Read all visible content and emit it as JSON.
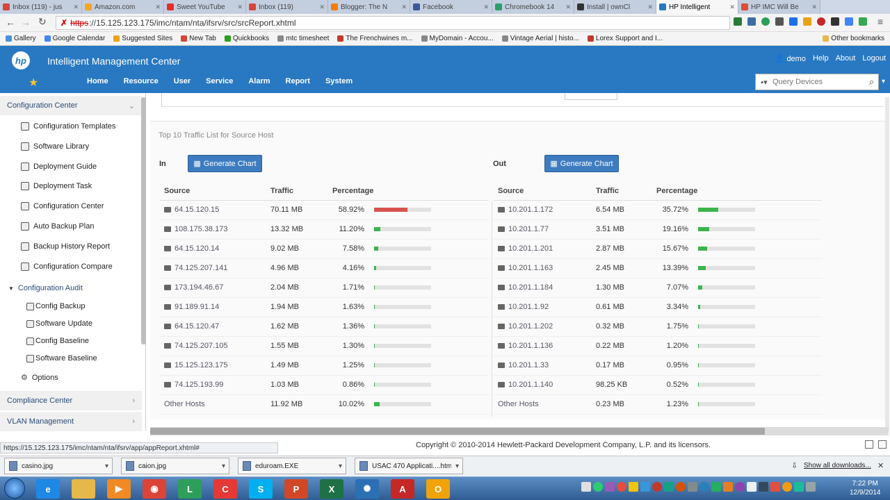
{
  "browser": {
    "tabs": [
      {
        "label": "Inbox (119) - jus",
        "color": "#d44638",
        "active": false
      },
      {
        "label": "Amazon.com",
        "color": "#f5a623",
        "active": false
      },
      {
        "label": "Sweet YouTube",
        "color": "#e52d27",
        "active": false
      },
      {
        "label": "Inbox (119)",
        "color": "#d44638",
        "active": false
      },
      {
        "label": "Blogger: The N",
        "color": "#f57d00",
        "active": false
      },
      {
        "label": "Facebook",
        "color": "#3b5998",
        "active": false
      },
      {
        "label": "Chromebook 14",
        "color": "#2b9f6a",
        "active": false
      },
      {
        "label": "Install | ownCl",
        "color": "#333333",
        "active": false
      },
      {
        "label": "HP Intelligent",
        "color": "#2878c2",
        "active": true
      },
      {
        "label": "HP IMC Will Be",
        "color": "#dd4b39",
        "active": false
      }
    ],
    "url_scheme": "https",
    "url_rest": "://15.125.123.175/imc/ntam/nta/ifsrv/src/srcReport.xhtml",
    "bookmarks": [
      {
        "label": "Gallery",
        "color": "#4a90d9"
      },
      {
        "label": "Google Calendar",
        "color": "#4285f4"
      },
      {
        "label": "Suggested Sites",
        "color": "#e8a317"
      },
      {
        "label": "New Tab",
        "color": "#d44638"
      },
      {
        "label": "Quickbooks",
        "color": "#2ca01c"
      },
      {
        "label": "mtc timesheet",
        "color": "#888888"
      },
      {
        "label": "The Frenchwines m...",
        "color": "#c0392b"
      },
      {
        "label": "MyDomain - Accou...",
        "color": "#888888"
      },
      {
        "label": "Vintage Aerial | histo...",
        "color": "#888888"
      },
      {
        "label": "Lorex Support and I...",
        "color": "#c0392b"
      }
    ],
    "other_bookmarks": "Other bookmarks"
  },
  "header": {
    "logo": "hp",
    "title": "Intelligent Management Center",
    "user": "demo",
    "help": "Help",
    "about": "About",
    "logout": "Logout",
    "nav": [
      "Home",
      "Resource",
      "User",
      "Service",
      "Alarm",
      "Report",
      "System"
    ],
    "query_placeholder": "Query Devices"
  },
  "sidebar": {
    "config_center": "Configuration Center",
    "items": [
      "Configuration Templates",
      "Software Library",
      "Deployment Guide",
      "Deployment Task",
      "Configuration Center",
      "Auto Backup Plan",
      "Backup History Report",
      "Configuration Compare"
    ],
    "audit_group": "Configuration Audit",
    "audit_items": [
      "Config Backup",
      "Software Update",
      "Config Baseline",
      "Software Baseline"
    ],
    "options": "Options",
    "compliance": "Compliance Center",
    "vlan": "VLAN Management"
  },
  "report": {
    "title": "Top 10 Traffic List for Source Host",
    "in_label": "In",
    "out_label": "Out",
    "generate_label": "Generate Chart",
    "columns": [
      "Source",
      "Traffic",
      "Percentage"
    ],
    "in_rows": [
      {
        "source": "64.15.120.15",
        "traffic": "70.11 MB",
        "pct": "58.92%",
        "value": 58.92,
        "color": "#d9534f"
      },
      {
        "source": "108.175.38.173",
        "traffic": "13.32 MB",
        "pct": "11.20%",
        "value": 11.2,
        "color": "#3cb44b"
      },
      {
        "source": "64.15.120.14",
        "traffic": "9.02 MB",
        "pct": "7.58%",
        "value": 7.58,
        "color": "#3cb44b"
      },
      {
        "source": "74.125.207.141",
        "traffic": "4.96 MB",
        "pct": "4.16%",
        "value": 4.16,
        "color": "#3cb44b"
      },
      {
        "source": "173.194.46.67",
        "traffic": "2.04 MB",
        "pct": "1.71%",
        "value": 1.71,
        "color": "#3cb44b"
      },
      {
        "source": "91.189.91.14",
        "traffic": "1.94 MB",
        "pct": "1.63%",
        "value": 1.63,
        "color": "#3cb44b"
      },
      {
        "source": "64.15.120.47",
        "traffic": "1.62 MB",
        "pct": "1.36%",
        "value": 1.36,
        "color": "#3cb44b"
      },
      {
        "source": "74.125.207.105",
        "traffic": "1.55 MB",
        "pct": "1.30%",
        "value": 1.3,
        "color": "#3cb44b"
      },
      {
        "source": "15.125.123.175",
        "traffic": "1.49 MB",
        "pct": "1.25%",
        "value": 1.25,
        "color": "#3cb44b"
      },
      {
        "source": "74.125.193.99",
        "traffic": "1.03 MB",
        "pct": "0.86%",
        "value": 0.86,
        "color": "#3cb44b"
      },
      {
        "source": "Other Hosts",
        "traffic": "11.92 MB",
        "pct": "10.02%",
        "value": 10.02,
        "color": "#3cb44b",
        "other": true
      }
    ],
    "out_rows": [
      {
        "source": "10.201.1.172",
        "traffic": "6.54 MB",
        "pct": "35.72%",
        "value": 35.72,
        "color": "#3cb44b"
      },
      {
        "source": "10.201.1.77",
        "traffic": "3.51 MB",
        "pct": "19.16%",
        "value": 19.16,
        "color": "#3cb44b"
      },
      {
        "source": "10.201.1.201",
        "traffic": "2.87 MB",
        "pct": "15.67%",
        "value": 15.67,
        "color": "#3cb44b"
      },
      {
        "source": "10.201.1.163",
        "traffic": "2.45 MB",
        "pct": "13.39%",
        "value": 13.39,
        "color": "#3cb44b"
      },
      {
        "source": "10.201.1.184",
        "traffic": "1.30 MB",
        "pct": "7.07%",
        "value": 7.07,
        "color": "#3cb44b"
      },
      {
        "source": "10.201.1.92",
        "traffic": "0.61 MB",
        "pct": "3.34%",
        "value": 3.34,
        "color": "#3cb44b"
      },
      {
        "source": "10.201.1.202",
        "traffic": "0.32 MB",
        "pct": "1.75%",
        "value": 1.75,
        "color": "#3cb44b"
      },
      {
        "source": "10.201.1.136",
        "traffic": "0.22 MB",
        "pct": "1.20%",
        "value": 1.2,
        "color": "#3cb44b"
      },
      {
        "source": "10.201.1.33",
        "traffic": "0.17 MB",
        "pct": "0.95%",
        "value": 0.95,
        "color": "#3cb44b"
      },
      {
        "source": "10.201.1.140",
        "traffic": "98.25 KB",
        "pct": "0.52%",
        "value": 0.52,
        "color": "#3cb44b"
      },
      {
        "source": "Other Hosts",
        "traffic": "0.23 MB",
        "pct": "1.23%",
        "value": 1.23,
        "color": "#3cb44b",
        "other": true
      }
    ]
  },
  "footer": {
    "status_url": "https://15.125.123.175/imc/ntam/nta/ifsrv/app/appReport.xhtml#",
    "copyright": "Copyright © 2010-2014 Hewlett-Packard Development Company, L.P. and its licensors."
  },
  "downloads": {
    "items": [
      "casino.jpg",
      "caion.jpg",
      "eduroam.EXE",
      "USAC 470 Applicati....html"
    ],
    "show_all": "Show all downloads..."
  },
  "taskbar": {
    "time": "7:22 PM",
    "date": "12/9/2014",
    "icons": [
      {
        "name": "ie",
        "color": "#1e88e5",
        "glyph": "e"
      },
      {
        "name": "explorer",
        "color": "#e6b84a",
        "glyph": ""
      },
      {
        "name": "media",
        "color": "#f08a24",
        "glyph": "▶"
      },
      {
        "name": "chrome",
        "color": "#db4437",
        "glyph": "◉"
      },
      {
        "name": "network",
        "color": "#2e9e5b",
        "glyph": "L"
      },
      {
        "name": "citrix",
        "color": "#e53935",
        "glyph": "C"
      },
      {
        "name": "skype",
        "color": "#00aff0",
        "glyph": "S"
      },
      {
        "name": "powerpoint",
        "color": "#d24726",
        "glyph": "P"
      },
      {
        "name": "excel",
        "color": "#1e7145",
        "glyph": "X"
      },
      {
        "name": "settings",
        "color": "#2c6fb5",
        "glyph": "✺"
      },
      {
        "name": "acrobat",
        "color": "#c62828",
        "glyph": "A"
      },
      {
        "name": "outlook",
        "color": "#f0a30a",
        "glyph": "O"
      }
    ]
  }
}
